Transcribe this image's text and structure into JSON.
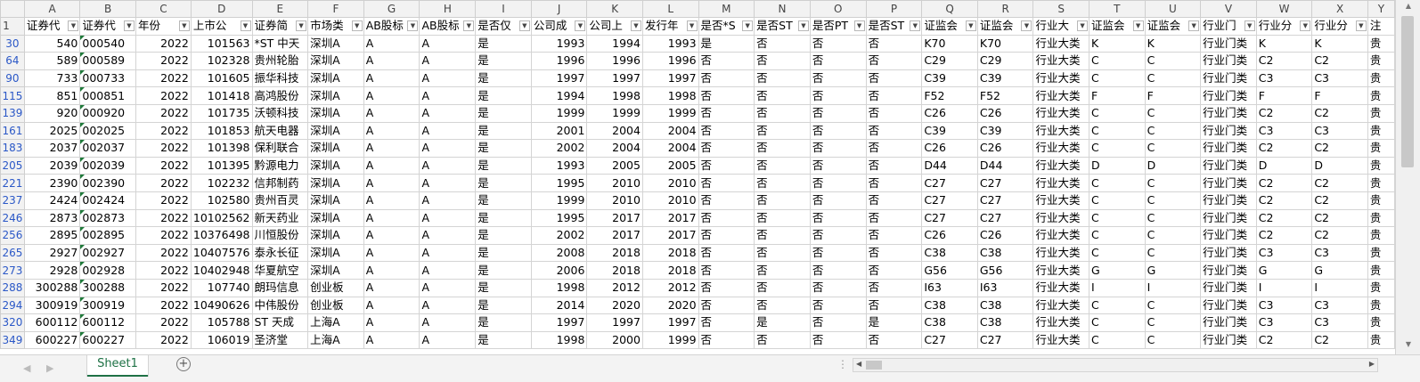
{
  "columns": [
    "A",
    "B",
    "C",
    "D",
    "E",
    "F",
    "G",
    "H",
    "I",
    "J",
    "K",
    "L",
    "M",
    "N",
    "O",
    "P",
    "Q",
    "R",
    "S",
    "T",
    "U",
    "V",
    "W",
    "X",
    "Y"
  ],
  "header_row_number": "1",
  "headers": [
    "证券代",
    "证券代",
    "年份",
    "上市公",
    "证券简",
    "市场类",
    "AB股标",
    "AB股标",
    "是否仅",
    "公司成",
    "公司上",
    "发行年",
    "是否*S",
    "是否ST",
    "是否PT",
    "是否ST",
    "证监会",
    "证监会",
    "行业大",
    "证监会",
    "证监会",
    "行业门",
    "行业分",
    "行业分",
    "注"
  ],
  "rows": [
    {
      "n": "30",
      "c": [
        "540",
        "000540",
        "2022",
        "101563",
        "*ST 中天",
        "深圳A",
        "A",
        "A",
        "是",
        "1993",
        "1994",
        "1993",
        "是",
        "否",
        "否",
        "否",
        "K70",
        "K70",
        "行业大类",
        "K",
        "K",
        "行业门类",
        "K",
        "K",
        "贵"
      ]
    },
    {
      "n": "64",
      "c": [
        "589",
        "000589",
        "2022",
        "102328",
        "贵州轮胎",
        "深圳A",
        "A",
        "A",
        "是",
        "1996",
        "1996",
        "1996",
        "否",
        "否",
        "否",
        "否",
        "C29",
        "C29",
        "行业大类",
        "C",
        "C",
        "行业门类",
        "C2",
        "C2",
        "贵"
      ]
    },
    {
      "n": "90",
      "c": [
        "733",
        "000733",
        "2022",
        "101605",
        "振华科技",
        "深圳A",
        "A",
        "A",
        "是",
        "1997",
        "1997",
        "1997",
        "否",
        "否",
        "否",
        "否",
        "C39",
        "C39",
        "行业大类",
        "C",
        "C",
        "行业门类",
        "C3",
        "C3",
        "贵"
      ]
    },
    {
      "n": "115",
      "c": [
        "851",
        "000851",
        "2022",
        "101418",
        "高鸿股份",
        "深圳A",
        "A",
        "A",
        "是",
        "1994",
        "1998",
        "1998",
        "否",
        "否",
        "否",
        "否",
        "F52",
        "F52",
        "行业大类",
        "F",
        "F",
        "行业门类",
        "F",
        "F",
        "贵"
      ]
    },
    {
      "n": "139",
      "c": [
        "920",
        "000920",
        "2022",
        "101735",
        "沃顿科技",
        "深圳A",
        "A",
        "A",
        "是",
        "1999",
        "1999",
        "1999",
        "否",
        "否",
        "否",
        "否",
        "C26",
        "C26",
        "行业大类",
        "C",
        "C",
        "行业门类",
        "C2",
        "C2",
        "贵"
      ]
    },
    {
      "n": "161",
      "c": [
        "2025",
        "002025",
        "2022",
        "101853",
        "航天电器",
        "深圳A",
        "A",
        "A",
        "是",
        "2001",
        "2004",
        "2004",
        "否",
        "否",
        "否",
        "否",
        "C39",
        "C39",
        "行业大类",
        "C",
        "C",
        "行业门类",
        "C3",
        "C3",
        "贵"
      ]
    },
    {
      "n": "183",
      "c": [
        "2037",
        "002037",
        "2022",
        "101398",
        "保利联合",
        "深圳A",
        "A",
        "A",
        "是",
        "2002",
        "2004",
        "2004",
        "否",
        "否",
        "否",
        "否",
        "C26",
        "C26",
        "行业大类",
        "C",
        "C",
        "行业门类",
        "C2",
        "C2",
        "贵"
      ]
    },
    {
      "n": "205",
      "c": [
        "2039",
        "002039",
        "2022",
        "101395",
        "黔源电力",
        "深圳A",
        "A",
        "A",
        "是",
        "1993",
        "2005",
        "2005",
        "否",
        "否",
        "否",
        "否",
        "D44",
        "D44",
        "行业大类",
        "D",
        "D",
        "行业门类",
        "D",
        "D",
        "贵"
      ]
    },
    {
      "n": "221",
      "c": [
        "2390",
        "002390",
        "2022",
        "102232",
        "信邦制药",
        "深圳A",
        "A",
        "A",
        "是",
        "1995",
        "2010",
        "2010",
        "否",
        "否",
        "否",
        "否",
        "C27",
        "C27",
        "行业大类",
        "C",
        "C",
        "行业门类",
        "C2",
        "C2",
        "贵"
      ]
    },
    {
      "n": "237",
      "c": [
        "2424",
        "002424",
        "2022",
        "102580",
        "贵州百灵",
        "深圳A",
        "A",
        "A",
        "是",
        "1999",
        "2010",
        "2010",
        "否",
        "否",
        "否",
        "否",
        "C27",
        "C27",
        "行业大类",
        "C",
        "C",
        "行业门类",
        "C2",
        "C2",
        "贵"
      ]
    },
    {
      "n": "246",
      "c": [
        "2873",
        "002873",
        "2022",
        "10102562",
        "新天药业",
        "深圳A",
        "A",
        "A",
        "是",
        "1995",
        "2017",
        "2017",
        "否",
        "否",
        "否",
        "否",
        "C27",
        "C27",
        "行业大类",
        "C",
        "C",
        "行业门类",
        "C2",
        "C2",
        "贵"
      ]
    },
    {
      "n": "256",
      "c": [
        "2895",
        "002895",
        "2022",
        "10376498",
        "川恒股份",
        "深圳A",
        "A",
        "A",
        "是",
        "2002",
        "2017",
        "2017",
        "否",
        "否",
        "否",
        "否",
        "C26",
        "C26",
        "行业大类",
        "C",
        "C",
        "行业门类",
        "C2",
        "C2",
        "贵"
      ]
    },
    {
      "n": "265",
      "c": [
        "2927",
        "002927",
        "2022",
        "10407576",
        "泰永长征",
        "深圳A",
        "A",
        "A",
        "是",
        "2008",
        "2018",
        "2018",
        "否",
        "否",
        "否",
        "否",
        "C38",
        "C38",
        "行业大类",
        "C",
        "C",
        "行业门类",
        "C3",
        "C3",
        "贵"
      ]
    },
    {
      "n": "273",
      "c": [
        "2928",
        "002928",
        "2022",
        "10402948",
        "华夏航空",
        "深圳A",
        "A",
        "A",
        "是",
        "2006",
        "2018",
        "2018",
        "否",
        "否",
        "否",
        "否",
        "G56",
        "G56",
        "行业大类",
        "G",
        "G",
        "行业门类",
        "G",
        "G",
        "贵"
      ]
    },
    {
      "n": "288",
      "c": [
        "300288",
        "300288",
        "2022",
        "107740",
        "朗玛信息",
        "创业板",
        "A",
        "A",
        "是",
        "1998",
        "2012",
        "2012",
        "否",
        "否",
        "否",
        "否",
        "I63",
        "I63",
        "行业大类",
        "I",
        "I",
        "行业门类",
        "I",
        "I",
        "贵"
      ]
    },
    {
      "n": "294",
      "c": [
        "300919",
        "300919",
        "2022",
        "10490626",
        "中伟股份",
        "创业板",
        "A",
        "A",
        "是",
        "2014",
        "2020",
        "2020",
        "否",
        "否",
        "否",
        "否",
        "C38",
        "C38",
        "行业大类",
        "C",
        "C",
        "行业门类",
        "C3",
        "C3",
        "贵"
      ]
    },
    {
      "n": "320",
      "c": [
        "600112",
        "600112",
        "2022",
        "105788",
        "ST 天成",
        "上海A",
        "A",
        "A",
        "是",
        "1997",
        "1997",
        "1997",
        "否",
        "是",
        "否",
        "是",
        "C38",
        "C38",
        "行业大类",
        "C",
        "C",
        "行业门类",
        "C3",
        "C3",
        "贵"
      ]
    },
    {
      "n": "349",
      "c": [
        "600227",
        "600227",
        "2022",
        "106019",
        "圣济堂",
        "上海A",
        "A",
        "A",
        "是",
        "1998",
        "2000",
        "1999",
        "否",
        "否",
        "否",
        "否",
        "C27",
        "C27",
        "行业大类",
        "C",
        "C",
        "行业门类",
        "C2",
        "C2",
        "贵"
      ]
    }
  ],
  "sheet_tab": "Sheet1",
  "add_sheet": "⊕",
  "split_dots": "⋮",
  "icons": {
    "filter": "filter-dropdown-icon",
    "filter_active": "filter-active-icon",
    "scroll_up": "▲",
    "scroll_down": "▼",
    "scroll_left": "◀",
    "scroll_right": "▶",
    "nav_prev": "◀",
    "nav_next": "▶"
  },
  "colors": {
    "accent": "#1e7145",
    "row_number": "#2b58c7",
    "header_bg": "#f2f2f2"
  }
}
